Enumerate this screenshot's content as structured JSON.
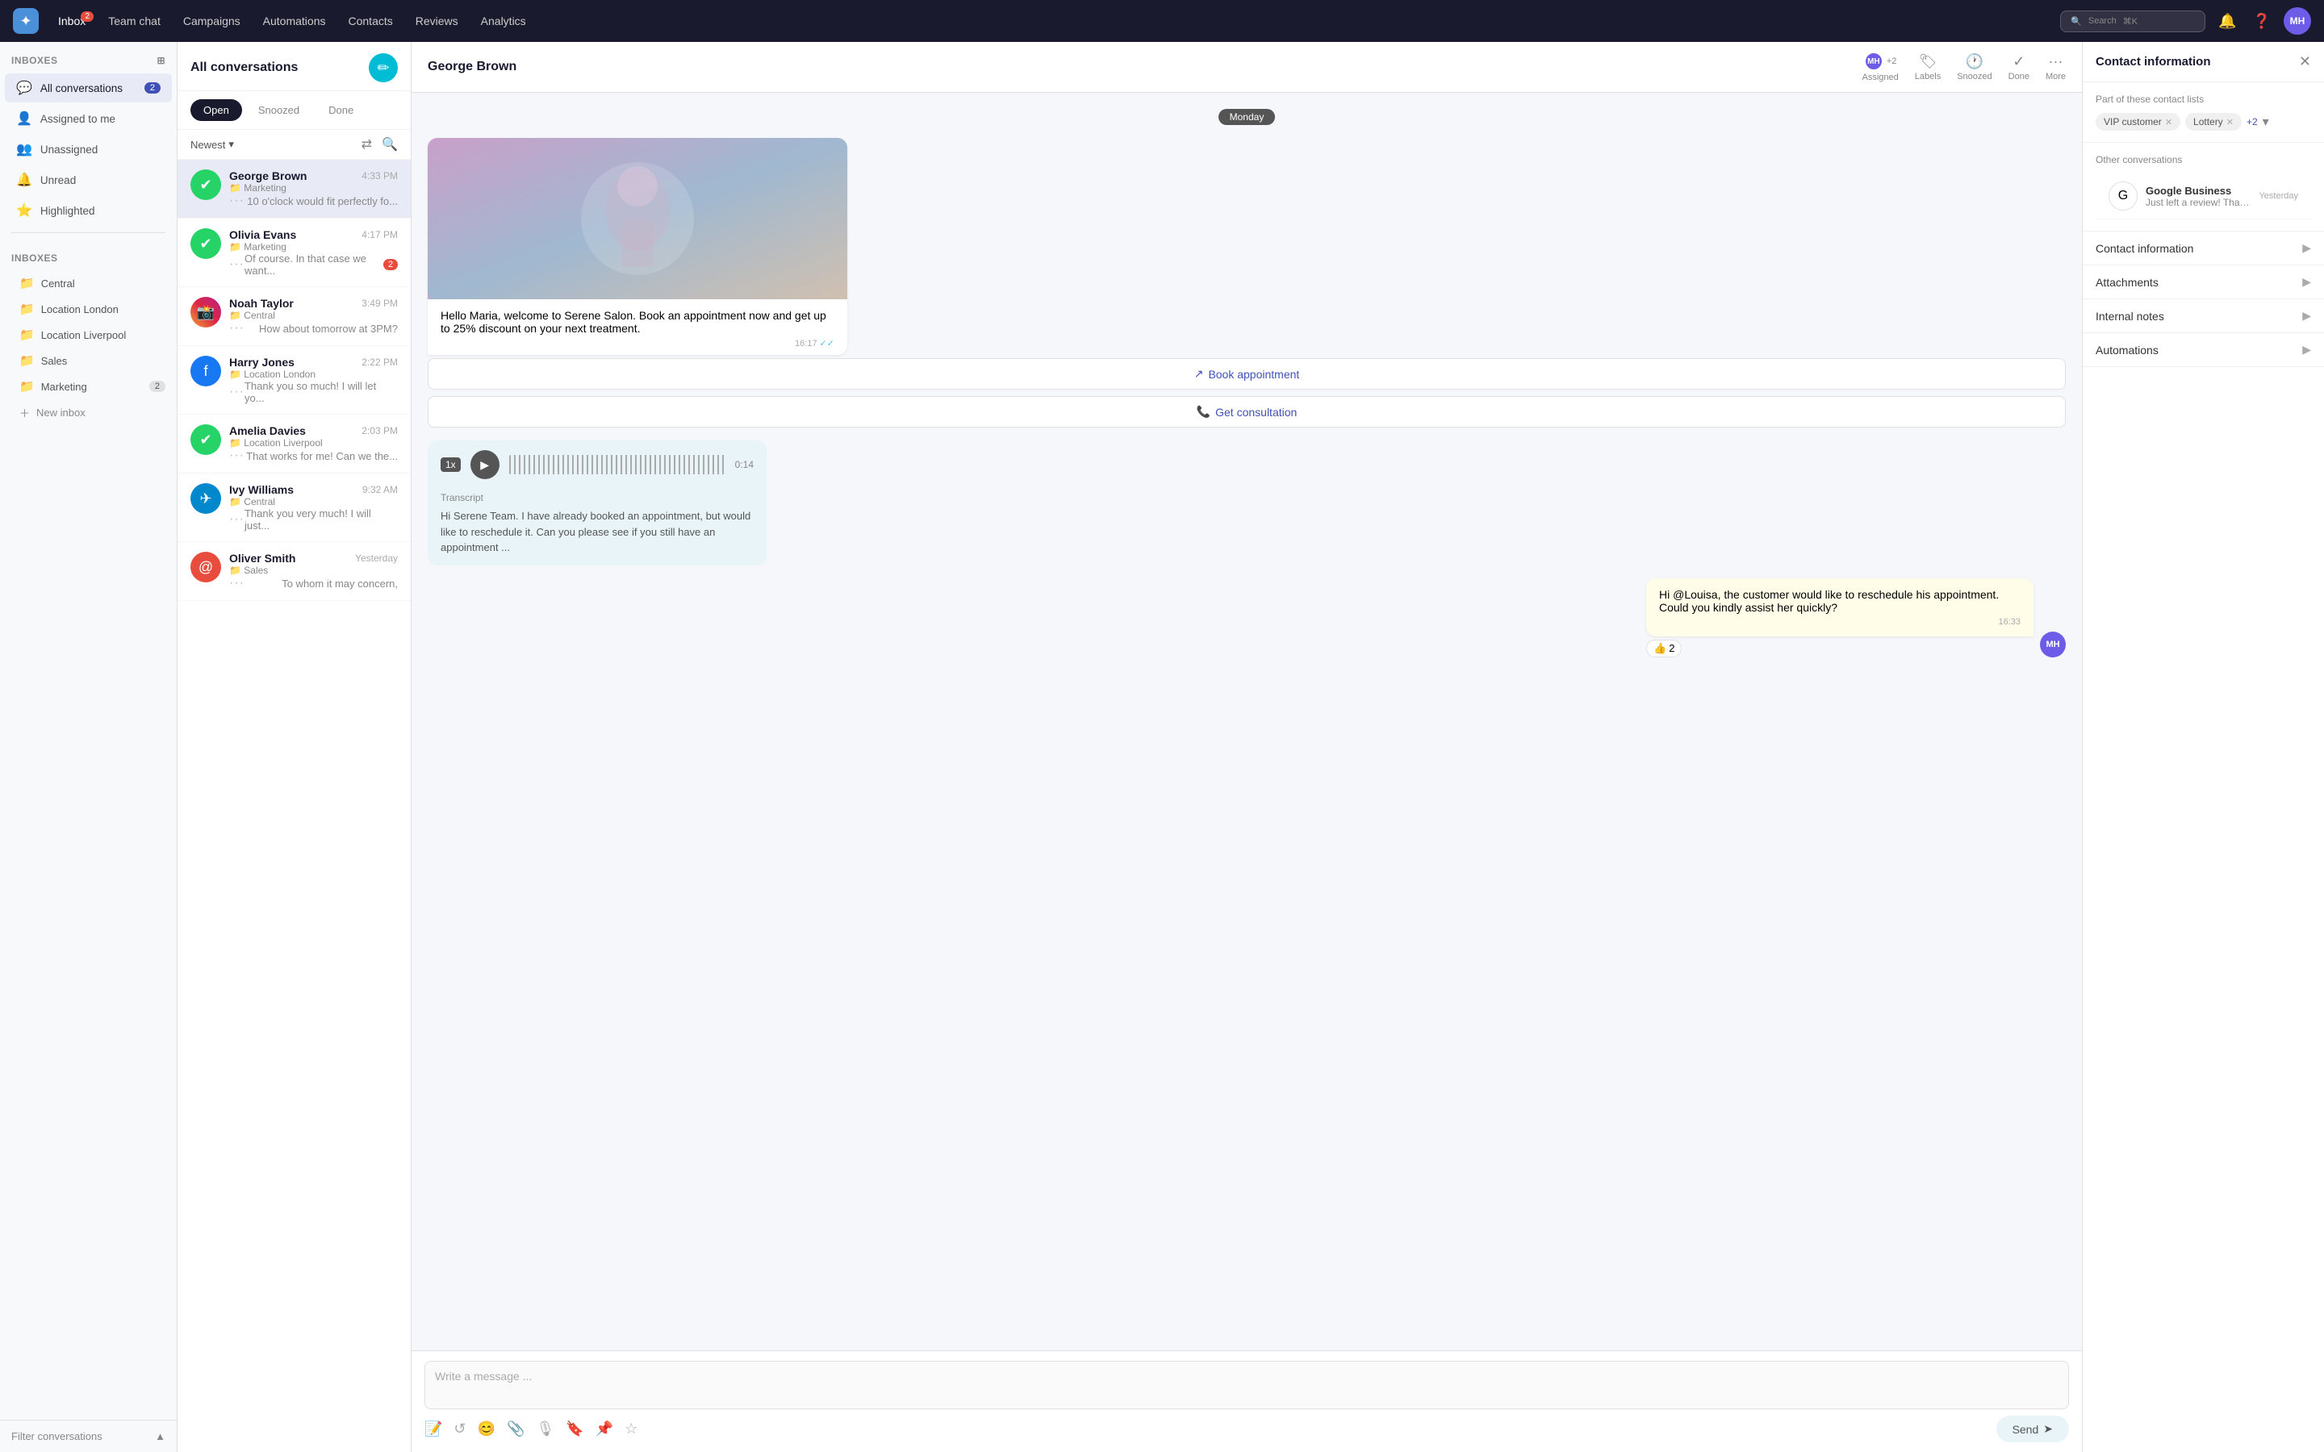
{
  "app": {
    "logo": "✦",
    "nav_items": [
      {
        "label": "Inbox",
        "badge": "2",
        "active": true
      },
      {
        "label": "Team chat",
        "badge": null,
        "active": false
      },
      {
        "label": "Campaigns",
        "badge": null,
        "active": false
      },
      {
        "label": "Automations",
        "badge": null,
        "active": false
      },
      {
        "label": "Contacts",
        "badge": null,
        "active": false
      },
      {
        "label": "Reviews",
        "badge": null,
        "active": false
      },
      {
        "label": "Analytics",
        "badge": null,
        "active": false
      }
    ],
    "search_placeholder": "Search",
    "search_shortcut": "⌘K",
    "user_initials": "MH"
  },
  "sidebar": {
    "section_label": "Inboxes",
    "main_items": [
      {
        "label": "All conversations",
        "badge": "2",
        "active": true,
        "icon": "💬"
      },
      {
        "label": "Assigned to me",
        "badge": null,
        "active": false,
        "icon": "👤"
      },
      {
        "label": "Unassigned",
        "badge": null,
        "active": false,
        "icon": "👥"
      },
      {
        "label": "Unread",
        "badge": null,
        "active": false,
        "icon": "🔔"
      },
      {
        "label": "Highlighted",
        "badge": null,
        "active": false,
        "icon": "⭐"
      }
    ],
    "inboxes_label": "Inboxes",
    "inbox_items": [
      {
        "label": "Central",
        "badge": null
      },
      {
        "label": "Location London",
        "badge": null
      },
      {
        "label": "Location Liverpool",
        "badge": null
      },
      {
        "label": "Sales",
        "badge": null
      },
      {
        "label": "Marketing",
        "badge": "2"
      }
    ],
    "new_inbox_label": "New inbox",
    "filter_label": "Filter conversations"
  },
  "conv_list": {
    "title": "All conversations",
    "tabs": [
      "Open",
      "Snoozed",
      "Done"
    ],
    "active_tab": "Open",
    "sort_label": "Newest",
    "conversations": [
      {
        "name": "George Brown",
        "channel": "whatsapp",
        "inbox": "Marketing",
        "time": "4:33 PM",
        "preview": "10 o'clock would fit perfectly fo...",
        "unread": null,
        "active": true
      },
      {
        "name": "Olivia Evans",
        "channel": "whatsapp",
        "inbox": "Marketing",
        "time": "4:17 PM",
        "preview": "Of course. In that case we want...",
        "unread": "2",
        "active": false
      },
      {
        "name": "Noah Taylor",
        "channel": "instagram",
        "inbox": "Central",
        "time": "3:49 PM",
        "preview": "How about tomorrow at 3PM?",
        "unread": null,
        "active": false
      },
      {
        "name": "Harry Jones",
        "channel": "facebook",
        "inbox": "Location London",
        "time": "2:22 PM",
        "preview": "Thank you so much! I will let yo...",
        "unread": null,
        "active": false
      },
      {
        "name": "Amelia Davies",
        "channel": "whatsapp",
        "inbox": "Location Liverpool",
        "time": "2:03 PM",
        "preview": "That works for me! Can we the...",
        "unread": null,
        "active": false
      },
      {
        "name": "Ivy Williams",
        "channel": "telegram",
        "inbox": "Central",
        "time": "9:32 AM",
        "preview": "Thank you very much! I will just...",
        "unread": null,
        "active": false
      },
      {
        "name": "Oliver Smith",
        "channel": "email",
        "inbox": "Sales",
        "time": "Yesterday",
        "preview": "To whom it may concern,",
        "unread": null,
        "active": false
      }
    ]
  },
  "chat": {
    "contact_name": "George Brown",
    "header_actions": [
      {
        "label": "Assigned",
        "icon": "👤"
      },
      {
        "label": "Labels",
        "icon": "🏷"
      },
      {
        "label": "Snoozed",
        "icon": "🕐"
      },
      {
        "label": "Done",
        "icon": "✓"
      },
      {
        "label": "More",
        "icon": "···"
      }
    ],
    "assigned_initials": "MH",
    "assigned_count": "+2",
    "date_divider": "Monday",
    "messages": [
      {
        "type": "incoming_image_text",
        "has_image": true,
        "text": "Hello Maria, welcome to Serene Salon. Book an appointment now and get up to 25% discount on your next treatment.",
        "time": "16:17",
        "read": true,
        "cta_buttons": [
          "Book appointment",
          "Get consultation"
        ]
      },
      {
        "type": "voice",
        "speed": "1x",
        "duration": "0:14",
        "transcript": "Hi Serene Team. I have already booked an appointment, but would like to reschedule it. Can you please see if you still have an appointment ..."
      },
      {
        "type": "outgoing",
        "text": "Hi @Louisa, the customer would like to reschedule his appointment. Could you kindly assist her quickly?",
        "time": "16:33",
        "reaction_emoji": "👍",
        "reaction_count": "2"
      }
    ],
    "input_placeholder": "Write a message ...",
    "send_label": "Send",
    "note_label": "Note"
  },
  "right_panel": {
    "title": "Contact information",
    "contact_lists_label": "Part of these contact lists",
    "tags": [
      "VIP customer",
      "Lottery"
    ],
    "tags_more": "+2",
    "other_convs_label": "Other conversations",
    "other_convs": [
      {
        "source": "Google Business",
        "time": "Yesterday",
        "preview": "Just left a review! Thank you! 😊"
      }
    ],
    "sections": [
      {
        "label": "Contact information"
      },
      {
        "label": "Attachments"
      },
      {
        "label": "Internal notes"
      },
      {
        "label": "Automations"
      }
    ]
  }
}
